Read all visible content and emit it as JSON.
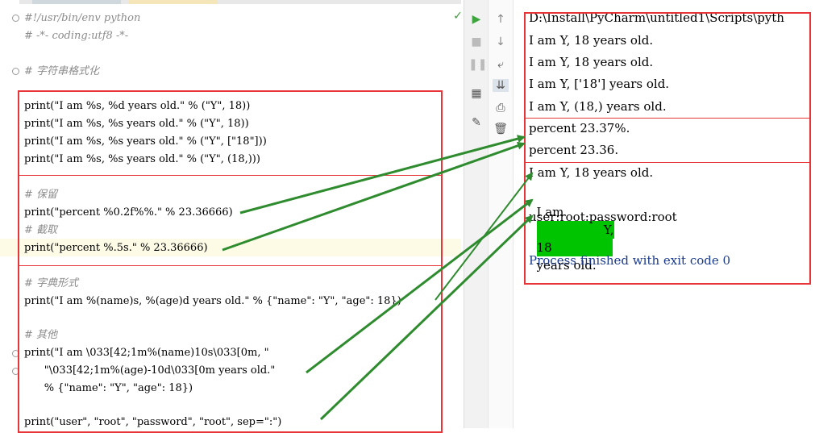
{
  "editor": {
    "lines": [
      {
        "text": "#!/usr/bin/env python",
        "kind": "comment"
      },
      {
        "text": "# -*- coding:utf8 -*-",
        "kind": "comment"
      },
      {
        "text": "# 字符串格式化",
        "kind": "comment"
      },
      {
        "text": "print(\"I am %s, %d years old.\" % (\"Y\", 18))",
        "kind": "code"
      },
      {
        "text": "print(\"I am %s, %s years old.\" % (\"Y\", 18))",
        "kind": "code"
      },
      {
        "text": "print(\"I am %s, %s years old.\" % (\"Y\", [\"18\"]))",
        "kind": "code"
      },
      {
        "text": "print(\"I am %s, %s years old.\" % (\"Y\", (18,)))",
        "kind": "code"
      },
      {
        "text": "# 保留",
        "kind": "comment"
      },
      {
        "text": "print(\"percent %0.2f%%.\" % 23.36666)",
        "kind": "code"
      },
      {
        "text": "# 截取",
        "kind": "comment"
      },
      {
        "text": "print(\"percent %.5s.\" % 23.36666)",
        "kind": "code"
      },
      {
        "text": "# 字典形式",
        "kind": "comment"
      },
      {
        "text": "print(\"I am %(name)s, %(age)d years old.\" % {\"name\": \"Y\", \"age\": 18})",
        "kind": "code"
      },
      {
        "text": "# 其他",
        "kind": "comment"
      },
      {
        "text": "print(\"I am \\033[42;1m%(name)10s\\033[0m, \"",
        "kind": "code"
      },
      {
        "text": "      \"\\033[42;1m%(age)-10d\\033[0m years old.\"",
        "kind": "code"
      },
      {
        "text": "      % {\"name\": \"Y\", \"age\": 18})",
        "kind": "code"
      },
      {
        "text": "print(\"user\", \"root\", \"password\", \"root\", sep=\":\")",
        "kind": "code"
      }
    ]
  },
  "console": {
    "path": "D:\\Install\\PyCharm\\untitled1\\Scripts\\pyth",
    "outputs": [
      "I am Y, 18 years old.",
      "I am Y, 18 years old.",
      "I am Y, ['18'] years old.",
      "I am Y, (18,) years old.",
      "percent 23.37%.",
      "percent 23.36.",
      "I am Y, 18 years old."
    ],
    "colored": {
      "prefix": "I am",
      "name": "Y,",
      "age": "18",
      "suffix": "years old."
    },
    "user_line": "user:root:password:root",
    "finish": "Process finished with exit code 0"
  },
  "icons": [
    "run-icon",
    "stop-icon",
    "pause-icon",
    "layout-icon",
    "pin-icon",
    "up-arrow-icon",
    "down-arrow-icon",
    "soft-wrap-icon",
    "scroll-end-icon",
    "print-icon",
    "trash-icon",
    "check-icon"
  ],
  "colors": {
    "annotation_red": "#e8353a",
    "arrow_green": "#2e8b2e",
    "ansi_green_bg": "#00c400"
  }
}
